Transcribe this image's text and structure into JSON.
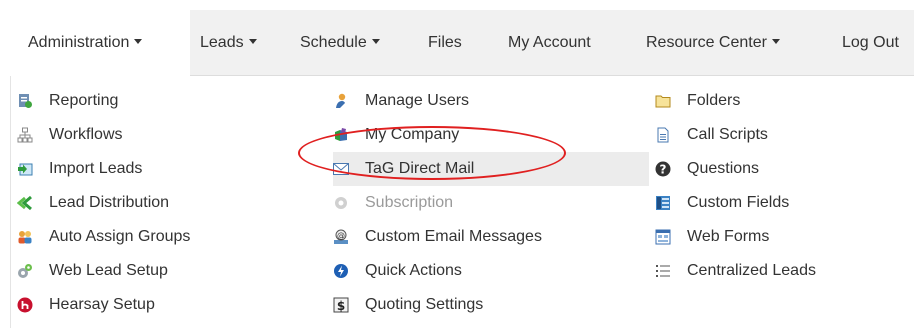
{
  "navbar": {
    "administration": "Administration",
    "leads": "Leads",
    "schedule": "Schedule",
    "files": "Files",
    "my_account": "My Account",
    "resource_center": "Resource Center",
    "log_out": "Log Out"
  },
  "menu": {
    "col1": [
      {
        "label": "Reporting",
        "icon": "reporting-icon"
      },
      {
        "label": "Workflows",
        "icon": "workflow-icon"
      },
      {
        "label": "Import Leads",
        "icon": "import-icon"
      },
      {
        "label": "Lead Distribution",
        "icon": "distribution-icon"
      },
      {
        "label": "Auto Assign Groups",
        "icon": "group-icon"
      },
      {
        "label": "Web Lead Setup",
        "icon": "gear-icon"
      },
      {
        "label": "Hearsay Setup",
        "icon": "hearsay-icon"
      }
    ],
    "col2": [
      {
        "label": "Manage Users",
        "icon": "user-icon"
      },
      {
        "label": "My Company",
        "icon": "company-icon"
      },
      {
        "label": "TaG Direct Mail",
        "icon": "envelope-icon",
        "highlighted": true
      },
      {
        "label": "Subscription",
        "icon": "gear-icon",
        "disabled": true
      },
      {
        "label": "Custom Email Messages",
        "icon": "email-user-icon"
      },
      {
        "label": "Quick Actions",
        "icon": "lightning-icon"
      },
      {
        "label": "Quoting Settings",
        "icon": "dollar-icon"
      }
    ],
    "col3": [
      {
        "label": "Folders",
        "icon": "folder-icon"
      },
      {
        "label": "Call Scripts",
        "icon": "document-icon"
      },
      {
        "label": "Questions",
        "icon": "question-icon"
      },
      {
        "label": "Custom Fields",
        "icon": "fields-icon"
      },
      {
        "label": "Web Forms",
        "icon": "form-icon"
      },
      {
        "label": "Centralized Leads",
        "icon": "list-icon"
      }
    ]
  },
  "colors": {
    "navbar_bg": "#f1f1f1",
    "highlight_bg": "#ececec",
    "callout_red": "#e02020",
    "disabled_text": "#9a9a9a"
  }
}
